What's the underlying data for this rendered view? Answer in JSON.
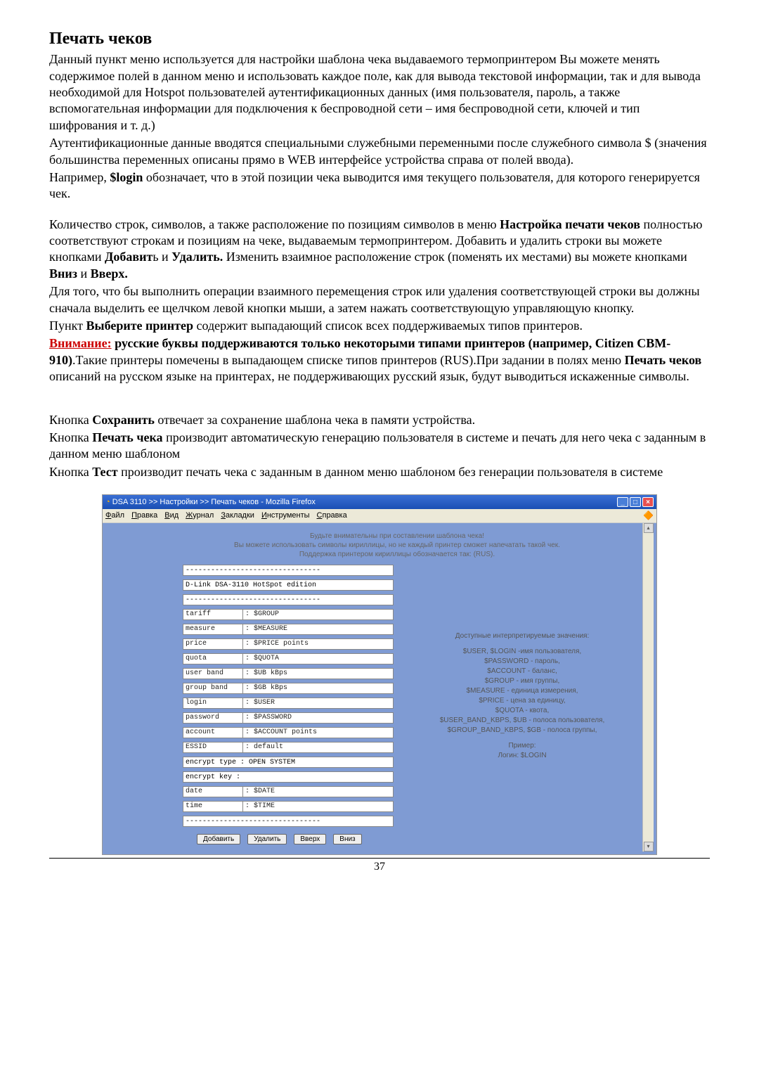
{
  "title": "Печать чеков",
  "p1": "Данный пункт меню используется для настройки шаблона чека выдаваемого термопринтером Вы можете менять содержимое полей в данном меню и использовать каждое поле, как для вывода текстовой информации, так и для вывода необходимой для Hotspot пользователей аутентификационных данных  (имя пользователя, пароль, а также вспомогательная информации для подключения к беспроводной сети – имя беспроводной сети, ключей и тип шифрования и т. д.)",
  "p2": "Аутентификационные данные вводятся специальными служебными переменными после служебного символа $ (значения большинства переменных описаны прямо в WEB интерфейсе устройства справа от полей ввода).",
  "p3a": "Например, ",
  "p3b": "$login",
  "p3c": " обозначает, что в этой позиции чека выводится имя текущего пользователя, для которого генерируется чек.",
  "p4a": "Количество строк, символов, а также расположение по позициям символов в меню ",
  "p4b": "Настройка печати чеков",
  "p4c": " полностью соответствуют строкам и позициям на чеке, выдаваемым термопринтером. Добавить и удалить строки вы можете кнопками ",
  "p4d": "Добавит",
  "p4e": "ь и ",
  "p4f": "Удалить.",
  "p4g": " Изменить взаимное расположение строк (поменять их местами) вы можете кнопками ",
  "p4h": "Вниз",
  "p4i": " и ",
  "p4j": "Вверх.",
  "p5": "Для того, что бы выполнить операции взаимного перемещения строк или удаления соответствующей строки вы должны сначала выделить ее щелчком  левой кнопки мыши, а затем нажать соответствующую управляющую кнопку.",
  "p6a": "Пункт ",
  "p6b": "Выберите принтер",
  "p6c": " содержит выпадающий список всех поддерживаемых типов принтеров.",
  "p7a": "Внимание:",
  "p7b": " русские буквы поддерживаются только некоторыми типами принтеров (например, Citizen CBM-910)",
  "p7c": ".Такие принтеры помечены в выпадающем списке типов принтеров (RUS).При задании в полях меню ",
  "p7d": "Печать чеков",
  "p7e": " описаний на русском языке на принтерах, не поддерживающих русский язык, будут выводиться искаженные символы.",
  "p8a": "Кнопка ",
  "p8b": "Сохранить",
  "p8c": " отвечает за сохранение шаблона чека в памяти устройства.",
  "p9a": "Кнопка ",
  "p9b": "Печать чека",
  "p9c": " производит  автоматическую генерацию пользователя в системе и печать для него чека с заданным в данном меню шаблоном",
  "p10a": "Кнопка ",
  "p10b": "Тест",
  "p10c": " производит печать чека с заданным в данном меню шаблоном без генерации пользователя в системе",
  "page_num": "37",
  "shot": {
    "titlebar": "DSA 3110 >> Настройки >> Печать чеков - Mozilla Firefox",
    "menu": [
      "Файл",
      "Правка",
      "Вид",
      "Журнал",
      "Закладки",
      "Инструменты",
      "Справка"
    ],
    "notice1": "Будьте внимательны при составлении шаблона чека!",
    "notice2": "Вы можете использовать символы кириллицы, но не каждый принтер сможет напечатать такой чек.",
    "notice3": "Поддержка принтером кириллицы обозначается так: (RUS).",
    "divider": "--------------------------------",
    "banner": "D-Link DSA-3110 HotSpot edition",
    "rows": [
      {
        "label": "tariff",
        "value": ": $GROUP"
      },
      {
        "label": "measure",
        "value": ": $MEASURE"
      },
      {
        "label": "price",
        "value": ": $PRICE points"
      },
      {
        "label": "quota",
        "value": ": $QUOTA"
      },
      {
        "label": "user band",
        "value": ": $UB kBps"
      },
      {
        "label": "group band",
        "value": ": $GB kBps"
      },
      {
        "label": "login",
        "value": ": $USER"
      },
      {
        "label": "password",
        "value": ": $PASSWORD"
      },
      {
        "label": "account",
        "value": ": $ACCOUNT points"
      },
      {
        "label": "ESSID",
        "value": ": default"
      }
    ],
    "full1": "encrypt type : OPEN SYSTEM",
    "full2": "encrypt key  :",
    "rows2": [
      {
        "label": "date",
        "value": ": $DATE"
      },
      {
        "label": "time",
        "value": ": $TIME"
      }
    ],
    "buttons": [
      "Добавить",
      "Удалить",
      "Вверх",
      "Вниз"
    ],
    "legend_title": "Доступные интерпретируемые значения:",
    "legend_lines": [
      "$USER, $LOGIN -имя пользователя,",
      "$PASSWORD - пароль,",
      "$ACCOUNT - баланс,",
      "$GROUP - имя группы,",
      "$MEASURE - единица измерения,",
      "$PRICE - цена за единицу,",
      "$QUOTA - квота,",
      "$USER_BAND_KBPS, $UB - полоса пользователя,",
      "$GROUP_BAND_KBPS, $GB - полоса группы,"
    ],
    "legend_ex1": "Пример:",
    "legend_ex2": "Логин: $LOGIN"
  }
}
